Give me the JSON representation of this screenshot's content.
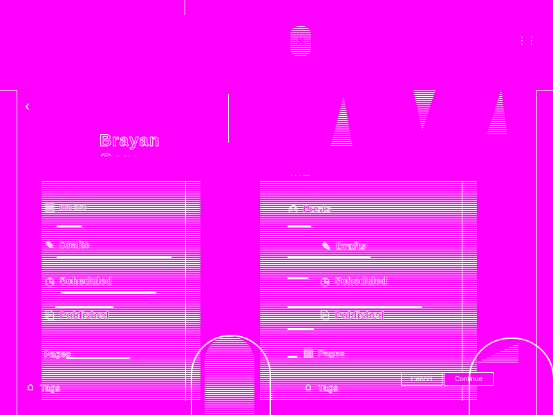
{
  "header": {
    "title": "Brayan Garc",
    "sub_label": "· · · —"
  },
  "left_menu": {
    "items": [
      {
        "icon": "document-icon",
        "label": "Info Info",
        "desc": "—"
      },
      {
        "icon": "pencil-icon",
        "label": "Drafts",
        "desc": "—"
      },
      {
        "icon": "clock-icon",
        "label": "Scheduled",
        "desc": "—"
      },
      {
        "icon": "checkmark-doc-icon",
        "label": "Published",
        "desc": "—"
      },
      {
        "icon": "pages-icon",
        "label": "Pages",
        "desc": "—"
      }
    ],
    "bottom_label": "Tags"
  },
  "right_menu": {
    "items": [
      {
        "icon": "document-icon",
        "label": "Posts"
      },
      {
        "icon": "pencil-icon",
        "label": "Drafts"
      },
      {
        "icon": "clock-icon",
        "label": "Scheduled"
      },
      {
        "icon": "checkmark-doc-icon",
        "label": "Published"
      },
      {
        "icon": "pages-icon",
        "label": "Pages"
      },
      {
        "icon": "tag-icon",
        "label": "Tags"
      }
    ]
  },
  "buttons": {
    "cancel": "Cancel",
    "confirm": "Continue"
  },
  "colors": {
    "background": "#ff00ff",
    "foreground": "#ffffff"
  }
}
